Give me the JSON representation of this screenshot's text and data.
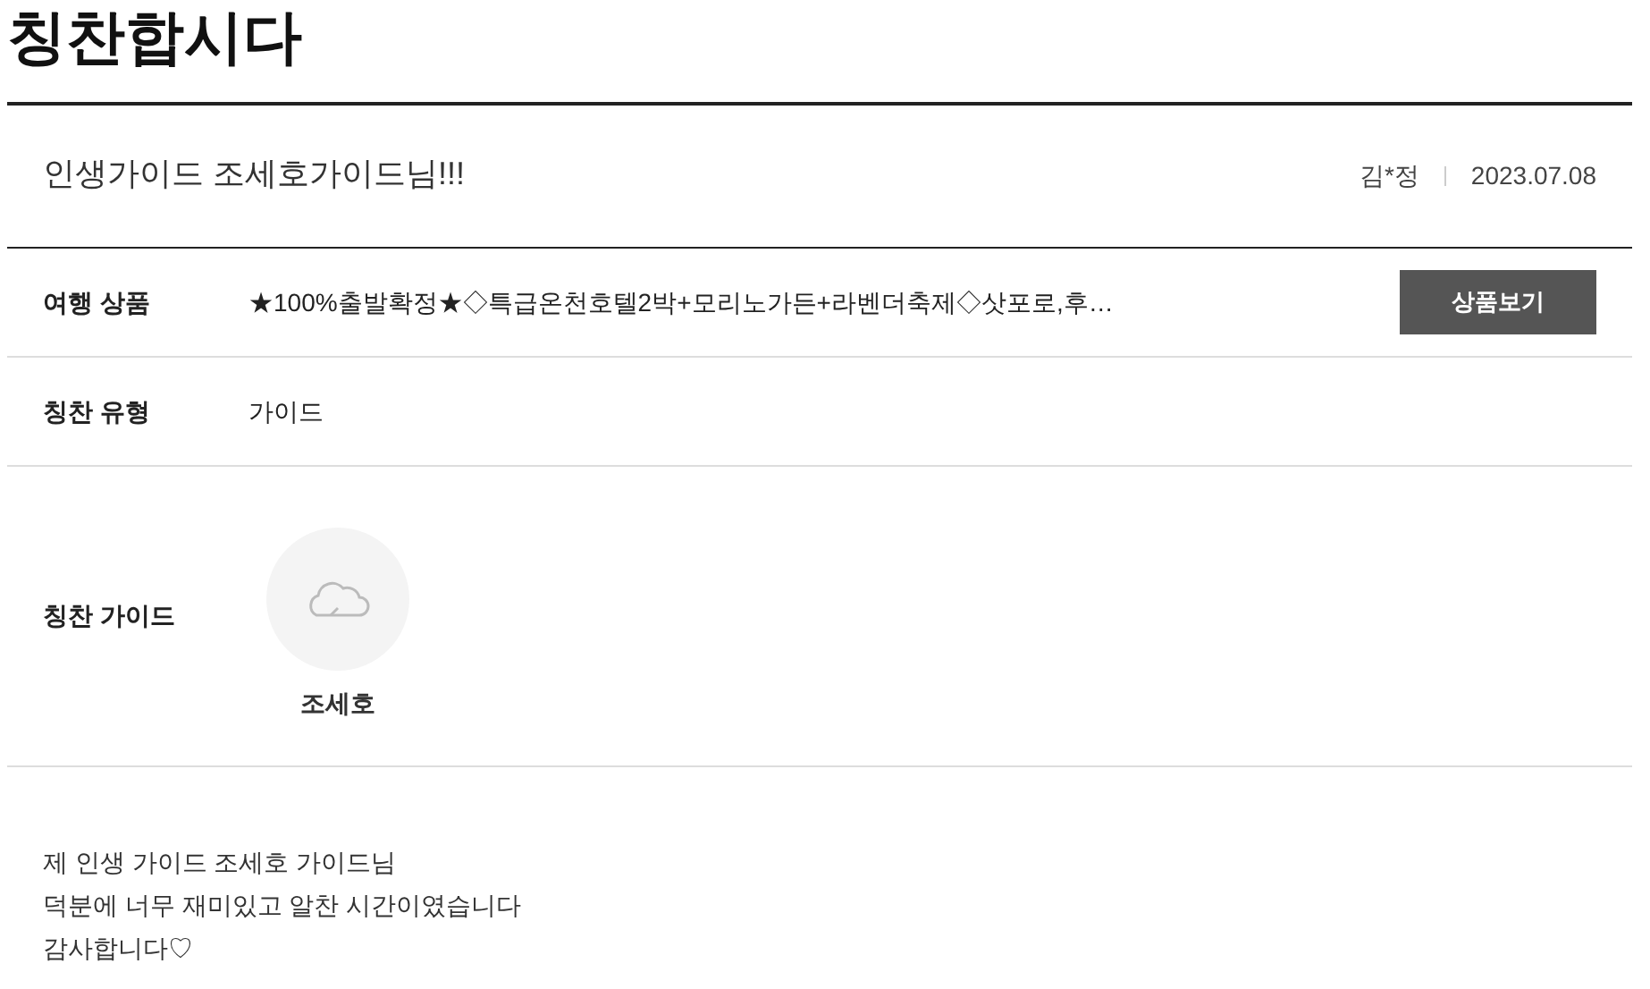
{
  "page_title": "칭찬합시다",
  "post": {
    "title": "인생가이드 조세호가이드님!!!",
    "author": "김*정",
    "date": "2023.07.08"
  },
  "fields": [
    {
      "kind": "product",
      "label": "여행 상품",
      "value": "★100%출발확정★◇특급온천호텔2박+모리노가든+라벤더축제◇삿포로,후…",
      "button": "상품보기"
    },
    {
      "kind": "text",
      "label": "칭찬 유형",
      "value": "가이드"
    },
    {
      "kind": "guide",
      "label": "칭찬 가이드",
      "value": "조세호"
    }
  ],
  "body": [
    "제 인생 가이드 조세호 가이드님",
    "덕분에 너무 재미있고 알찬 시간이였습니다",
    "감사합니다♡"
  ]
}
